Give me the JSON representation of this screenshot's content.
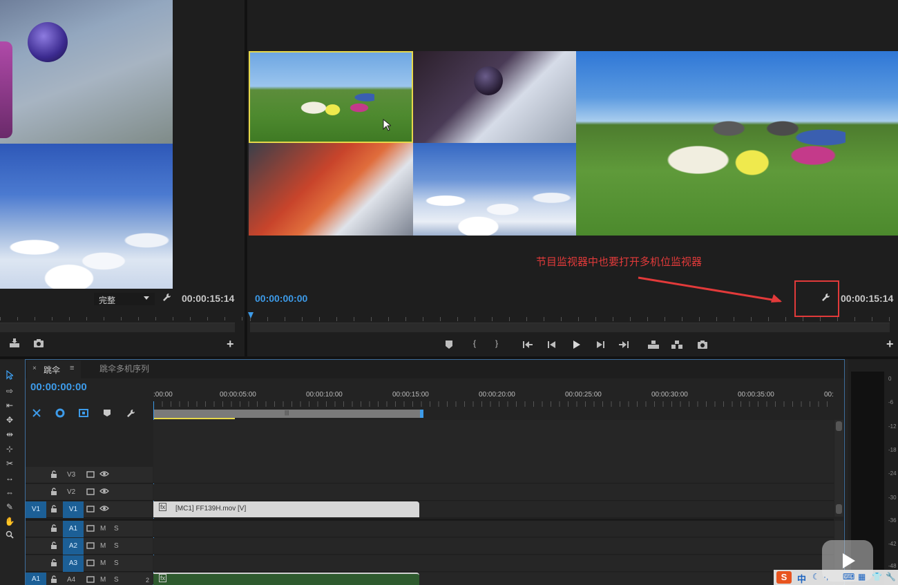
{
  "source_monitor": {
    "fit_select": "完整",
    "timecode": "00:00:15:14"
  },
  "program_monitor": {
    "timecode_left": "00:00:00:00",
    "timecode_right": "00:00:15:14",
    "annotation": "节目监视器中也要打开多机位监视器"
  },
  "timeline": {
    "tabs": [
      {
        "label": "跳伞",
        "active": true
      },
      {
        "label": "跳伞多机序列",
        "active": false
      }
    ],
    "current_time": "00:00:00:00",
    "ruler_labels": [
      ":00:00",
      "00:00:05:00",
      "00:00:10:00",
      "00:00:15:00",
      "00:00:20:00",
      "00:00:25:00",
      "00:00:30:00",
      "00:00:35:00",
      "00:"
    ],
    "video_tracks": [
      {
        "name": "V3",
        "source": ""
      },
      {
        "name": "V2",
        "source": ""
      },
      {
        "name": "V1",
        "source": "V1"
      }
    ],
    "audio_tracks": [
      {
        "name": "A1",
        "source": "",
        "m": "M",
        "s": "S"
      },
      {
        "name": "A2",
        "source": "",
        "m": "M",
        "s": "S"
      },
      {
        "name": "A3",
        "source": "",
        "m": "M",
        "s": "S"
      },
      {
        "name": "A4",
        "source": "A1",
        "m": "M",
        "s": "S"
      }
    ],
    "v1_clip": "[MC1] FF139H.mov [V]",
    "a4_extra": "2",
    "fx_label": "fx"
  },
  "audio_meter": {
    "labels": [
      "0",
      "-6",
      "-12",
      "-18",
      "-24",
      "-30",
      "-36",
      "-42",
      "-48"
    ]
  },
  "system_tray": {
    "ime_char": "中"
  },
  "colors": {
    "accent_blue": "#3d9be9",
    "track_selected": "#1c5f96",
    "annotation_red": "#e23a3a",
    "selected_cam_border": "#e7d84a",
    "audio_clip_green": "#2e5a2e"
  }
}
